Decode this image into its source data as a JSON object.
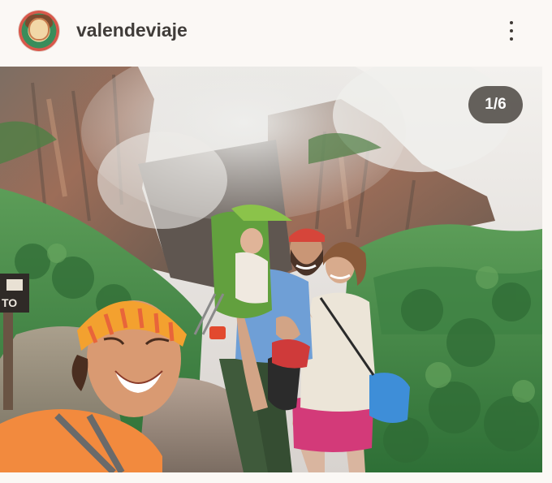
{
  "post": {
    "username": "valendeviaje",
    "counter": "1/6",
    "sign_text": "TO"
  },
  "colors": {
    "background": "#fbf8f5",
    "counter_bg": "#3c3732",
    "foliage": "#4a8f4b"
  },
  "icons": {
    "more": "more-vertical-icon"
  }
}
